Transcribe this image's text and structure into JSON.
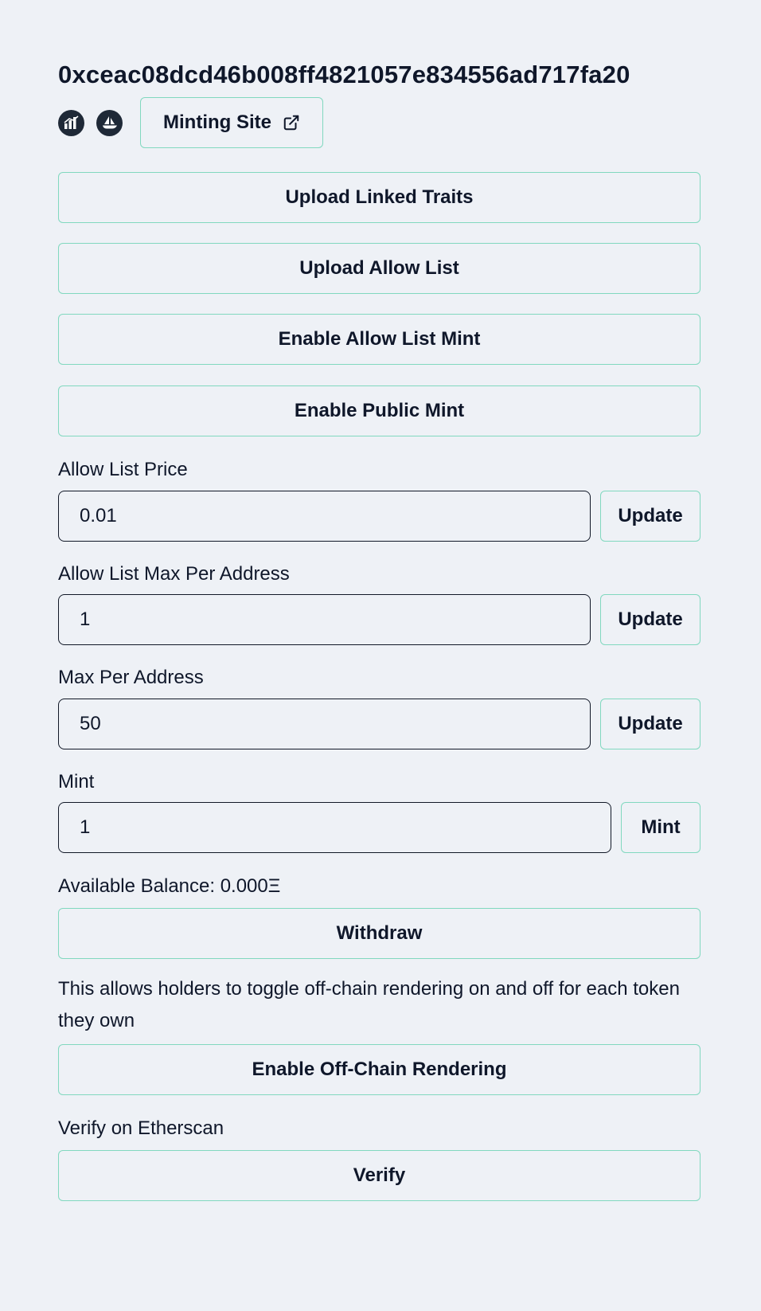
{
  "contract": {
    "address": "0xceac08dcd46b008ff4821057e834556ad717fa20"
  },
  "links": {
    "analytics_icon": "bar-chart-icon",
    "opensea_icon": "sailboat-icon",
    "minting_site_label": "Minting Site"
  },
  "actions": {
    "upload_linked_traits": "Upload Linked Traits",
    "upload_allow_list": "Upload Allow List",
    "enable_allow_list_mint": "Enable Allow List Mint",
    "enable_public_mint": "Enable Public Mint"
  },
  "allow_list_price": {
    "label": "Allow List Price",
    "value": "0.01",
    "button": "Update"
  },
  "allow_list_max_per_address": {
    "label": "Allow List Max Per Address",
    "value": "1",
    "button": "Update"
  },
  "max_per_address": {
    "label": "Max Per Address",
    "value": "50",
    "button": "Update"
  },
  "mint": {
    "label": "Mint",
    "value": "1",
    "button": "Mint"
  },
  "balance": {
    "text": "Available Balance: 0.000Ξ",
    "withdraw_label": "Withdraw"
  },
  "off_chain": {
    "description": "This allows holders to toggle off-chain rendering on and off for each token they own",
    "button": "Enable Off-Chain Rendering"
  },
  "etherscan": {
    "label": "Verify on Etherscan",
    "button": "Verify"
  },
  "colors": {
    "background": "#eef1f6",
    "button_border": "#81d8bf",
    "text": "#0f172a"
  }
}
